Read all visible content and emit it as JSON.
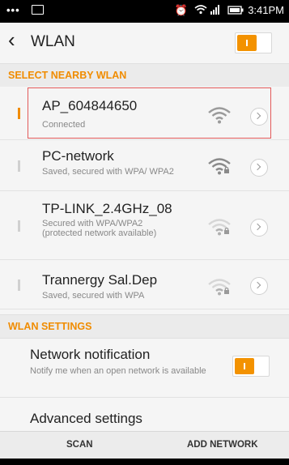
{
  "status_bar": {
    "left_icons": [
      "dots-icon",
      "image-icon"
    ],
    "time": "3:41PM",
    "right_icons": [
      "alarm-icon",
      "wifi-icon",
      "signal-icon",
      "battery-icon"
    ]
  },
  "header": {
    "title": "WLAN",
    "wlan_enabled": true
  },
  "sections": {
    "nearby": "SELECT NEARBY WLAN",
    "settings": "WLAN SETTINGS"
  },
  "networks": [
    {
      "name": "AP_604844650",
      "status": "Connected",
      "secured": false,
      "active": true
    },
    {
      "name": "PC-network",
      "status": "Saved, secured with WPA/ WPA2",
      "secured": true,
      "active": false
    },
    {
      "name": "TP-LINK_2.4GHz_08",
      "status": "Secured with WPA/WPA2 (protected network available)",
      "secured": true,
      "active": false
    },
    {
      "name": "Trannergy Sal.Dep",
      "status": "Saved, secured with WPA",
      "secured": true,
      "active": false
    }
  ],
  "settings": {
    "notification_title": "Network notification",
    "notification_sub": "Notify me when an open network is available",
    "notification_enabled": true,
    "advanced": "Advanced settings"
  },
  "bottom": {
    "scan": "SCAN",
    "add": "ADD NETWORK"
  },
  "colors": {
    "accent": "#f08c00",
    "highlight": "#e35a5a"
  }
}
